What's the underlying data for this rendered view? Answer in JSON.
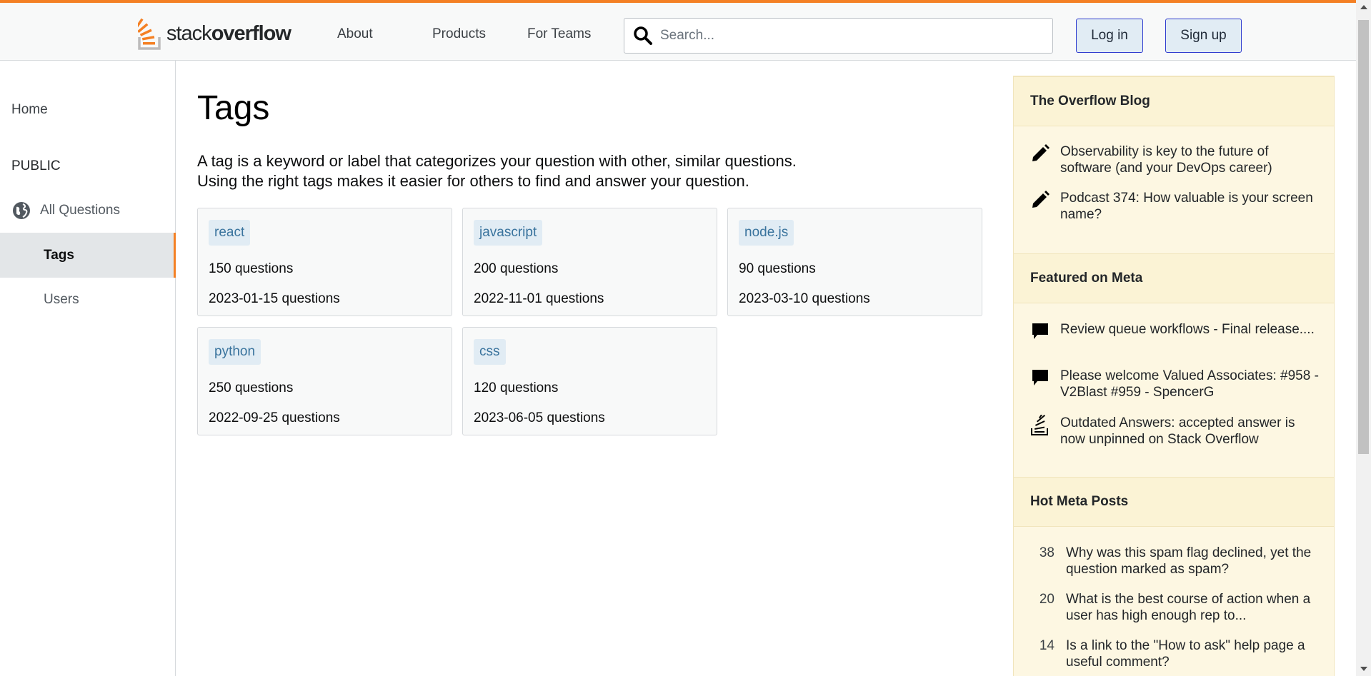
{
  "header": {
    "logo_light": "stack",
    "logo_bold": "overflow",
    "nav": [
      "About",
      "Products",
      "For Teams"
    ],
    "search": {
      "placeholder": "Search...",
      "value": ""
    },
    "login_label": "Log in",
    "signup_label": "Sign up",
    "accent_color": "#f48024"
  },
  "sidebar": {
    "home": "Home",
    "section": "PUBLIC",
    "all_questions": "All Questions",
    "tags": "Tags",
    "users": "Users",
    "active_item": "Tags"
  },
  "main": {
    "title": "Tags",
    "intro_line1": "A tag is a keyword or label that categorizes your question with other, similar questions.",
    "intro_line2": "Using the right tags makes it easier for others to find and answer your question.",
    "tags": [
      {
        "name": "react",
        "count": "150 questions",
        "date": "2023-01-15 questions"
      },
      {
        "name": "javascript",
        "count": "200 questions",
        "date": "2022-11-01 questions"
      },
      {
        "name": "node.js",
        "count": "90 questions",
        "date": "2023-03-10 questions"
      },
      {
        "name": "python",
        "count": "250 questions",
        "date": "2022-09-25 questions"
      },
      {
        "name": "css",
        "count": "120 questions",
        "date": "2023-06-05 questions"
      }
    ]
  },
  "widget": {
    "blog_title": "The Overflow Blog",
    "blog_items": [
      {
        "icon": "pencil-icon",
        "text": "Observability is key to the future of software (and your DevOps career)"
      },
      {
        "icon": "pencil-icon",
        "text": "Podcast 374: How valuable is your screen name?"
      }
    ],
    "meta_title": "Featured on Meta",
    "meta_items": [
      {
        "icon": "comment-icon",
        "text": "Review queue workflows - Final release...."
      },
      {
        "icon": "comment-icon",
        "text": "Please welcome Valued Associates: #958 - V2Blast #959 - SpencerG"
      },
      {
        "icon": "stackoverflow-icon",
        "text": "Outdated Answers: accepted answer is now unpinned on Stack Overflow"
      }
    ],
    "hot_title": "Hot Meta Posts",
    "hot_items": [
      {
        "score": "38",
        "text": "Why was this spam flag declined, yet the question marked as spam?"
      },
      {
        "score": "20",
        "text": "What is the best course of action when a user has high enough rep to..."
      },
      {
        "score": "14",
        "text": "Is a link to the \"How to ask\" help page a useful comment?"
      }
    ]
  }
}
